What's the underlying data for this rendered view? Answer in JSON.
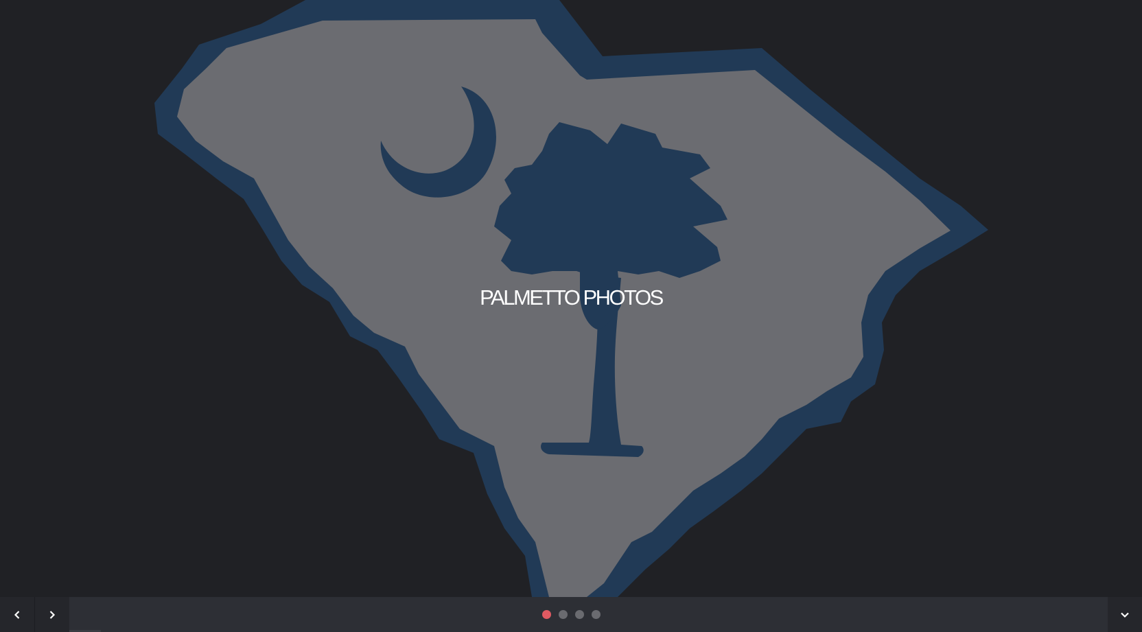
{
  "hero": {
    "title": "PALMETTO PHOTOS",
    "image": "south-carolina-state-with-palmetto-and-crescent",
    "colors": {
      "background": "#202125",
      "state_fill": "#6b6c71",
      "state_outline": "#213a56",
      "emblem": "#213a56",
      "title_text": "#ffffff"
    }
  },
  "slider": {
    "prev_icon": "chevron-left-icon",
    "next_icon": "chevron-right-icon",
    "toggle_icon": "chevron-down-icon",
    "slide_count": 4,
    "active_slide": 1,
    "colors": {
      "bar": "#2d2f35",
      "dot": "#6a6b70",
      "dot_active": "#e05a62"
    }
  }
}
